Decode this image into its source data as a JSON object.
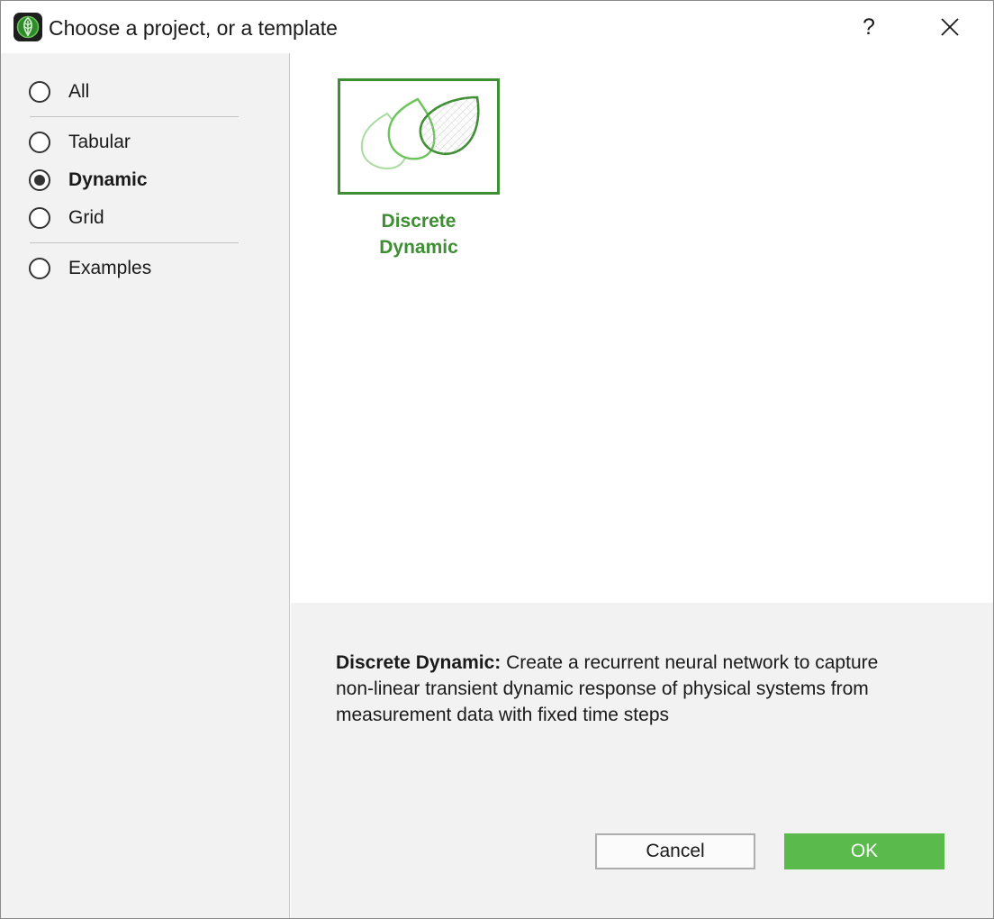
{
  "window": {
    "title": "Choose a project, or a template",
    "app_icon": "leaf-logo-icon",
    "help_label": "?",
    "close_icon": "close-icon"
  },
  "sidebar": {
    "options": [
      {
        "label": "All",
        "checked": false
      },
      {
        "label": "Tabular",
        "checked": false
      },
      {
        "label": "Dynamic",
        "checked": true
      },
      {
        "label": "Grid",
        "checked": false
      },
      {
        "label": "Examples",
        "checked": false
      }
    ]
  },
  "templates": [
    {
      "label_line1": "Discrete",
      "label_line2": "Dynamic",
      "icon": "leaves-icon",
      "selected": true
    }
  ],
  "description": {
    "title": "Discrete Dynamic:",
    "text": " Create a recurrent neural network to capture non-linear transient dynamic response of physical systems from measurement data with fixed time steps"
  },
  "buttons": {
    "cancel": "Cancel",
    "ok": "OK"
  },
  "colors": {
    "accent_green": "#3e8e33",
    "ok_green": "#5abb4c",
    "panel_gray": "#f2f2f2"
  }
}
